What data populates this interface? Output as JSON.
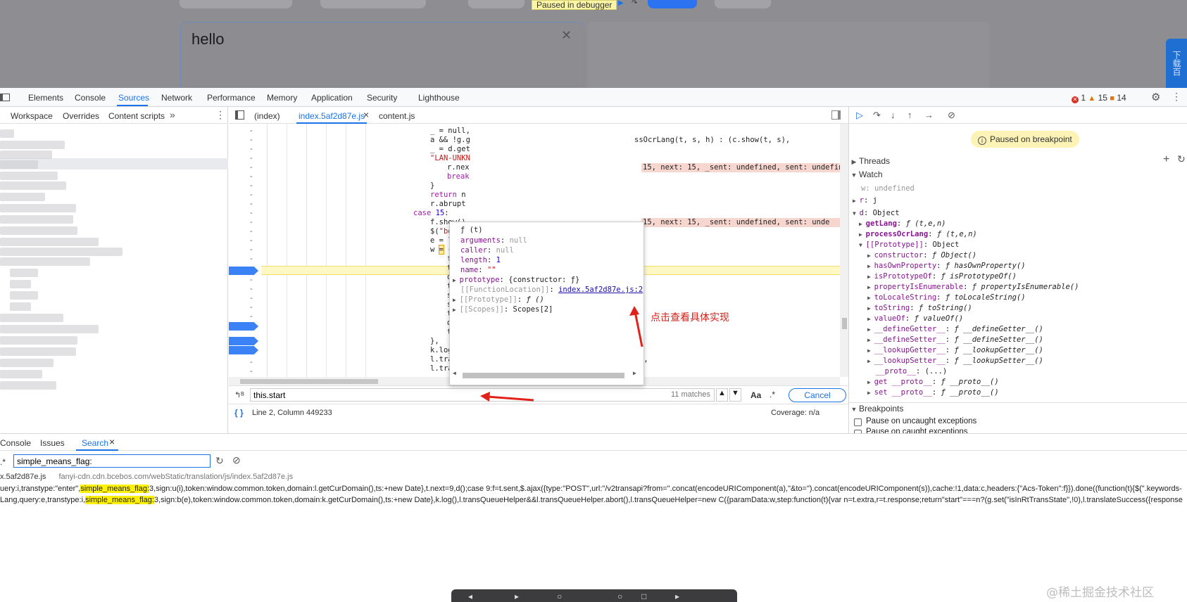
{
  "webpage": {
    "debugger_badge": "Paused in debugger",
    "input_text": "hello",
    "close_glyph": "✕",
    "side_banner": "下载百"
  },
  "devtools": {
    "tabs": [
      "Elements",
      "Console",
      "Sources",
      "Network",
      "Performance",
      "Memory",
      "Application",
      "Security",
      "Lighthouse"
    ],
    "active_tab": "Sources",
    "errors": "1",
    "warnings": "15",
    "issues": "14"
  },
  "navigator": {
    "tabs": [
      "Workspace",
      "Overrides",
      "Content scripts"
    ],
    "more": "»"
  },
  "editor": {
    "tabs": [
      "(index)",
      "index.5af2d87e.js",
      "content.js"
    ],
    "active_tab": "index.5af2d87e.js",
    "search": {
      "query": "this.start",
      "count": "11 matches",
      "match_case": "Aa",
      "regex": ".*",
      "cancel": "Cancel"
    },
    "status": {
      "position": "Line 2, Column 449233",
      "coverage": "Coverage: n/a"
    }
  },
  "popover": {
    "title": "ƒ (t)",
    "rows": [
      {
        "key": "arguments",
        "value": "null"
      },
      {
        "key": "caller",
        "value": "null"
      },
      {
        "key": "length",
        "value": "1"
      },
      {
        "key": "name",
        "value": "\"\""
      },
      {
        "key": "prototype",
        "value": "{constructor: ƒ}"
      },
      {
        "key": "[[FunctionLocation]]",
        "value": "index.5af2d87e.js:2"
      },
      {
        "key": "[[Prototype]]",
        "value": "ƒ ()"
      },
      {
        "key": "[[Scopes]]",
        "value": "Scopes[2]"
      }
    ]
  },
  "annotation": {
    "text": "点击查看具体实现"
  },
  "debugger": {
    "paused_banner": "Paused on breakpoint",
    "threads": "Threads",
    "watch": "Watch",
    "breakpoints": "Breakpoints",
    "pause_uncaught": "Pause on uncaught exceptions",
    "pause_caught": "Pause on caught exceptions",
    "watch_rows": [
      {
        "key": "w",
        "sep": ": ",
        "value": "undefined"
      },
      {
        "key": "r",
        "sep": ": ",
        "value": "j"
      },
      {
        "key": "d",
        "sep": ": ",
        "value": "Object"
      },
      {
        "key": "getLang",
        "sep": ": ",
        "value": "ƒ (t,e,n)"
      },
      {
        "key": "processOcrLang",
        "sep": ": ",
        "value": "ƒ (t,e,n)"
      },
      {
        "key": "[[Prototype]]",
        "sep": ": ",
        "value": "Object"
      },
      {
        "key": "constructor",
        "sep": ": ",
        "value": "ƒ Object()"
      },
      {
        "key": "hasOwnProperty",
        "sep": ": ",
        "value": "ƒ hasOwnProperty()"
      },
      {
        "key": "isPrototypeOf",
        "sep": ": ",
        "value": "ƒ isPrototypeOf()"
      },
      {
        "key": "propertyIsEnumerable",
        "sep": ": ",
        "value": "ƒ propertyIsEnumerable()"
      },
      {
        "key": "toLocaleString",
        "sep": ": ",
        "value": "ƒ toLocaleString()"
      },
      {
        "key": "toString",
        "sep": ": ",
        "value": "ƒ toString()"
      },
      {
        "key": "valueOf",
        "sep": ": ",
        "value": "ƒ valueOf()"
      },
      {
        "key": "__defineGetter__",
        "sep": ": ",
        "value": "ƒ __defineGetter__()"
      },
      {
        "key": "__defineSetter__",
        "sep": ": ",
        "value": "ƒ __defineSetter__()"
      },
      {
        "key": "__lookupGetter__",
        "sep": ": ",
        "value": "ƒ __lookupGetter__()"
      },
      {
        "key": "__lookupSetter__",
        "sep": ": ",
        "value": "ƒ __lookupSetter__()"
      },
      {
        "key": "__proto__",
        "sep": ": ",
        "value": "(...)"
      },
      {
        "key": "get __proto__",
        "sep": ": ",
        "value": "ƒ __proto__()"
      },
      {
        "key": "set __proto__",
        "sep": ": ",
        "value": "ƒ __proto__()"
      }
    ]
  },
  "drawer": {
    "tabs": [
      "Console",
      "Issues",
      "Search"
    ],
    "active_tab": "Search",
    "regex": ".*",
    "search_value": "simple_means_flag:",
    "result_file": "x.5af2d87e.js",
    "result_url": "fanyi-cdn.cdn.bcebos.com/webStatic/translation/js/index.5af2d87e.js",
    "line1_pre": "uery:i,transtype:\"enter\",",
    "line1_hl": "simple_means_flag:",
    "line1_post": "3,sign:u(i),token:window.common.token,domain:l.getCurDomain(),ts:+new Date},t.next=9,d();case 9:f=t.sent,$.ajax({type:\"POST\",url:\"/v2transapi?from=\".concat(encodeURIComponent(a),\"&to=\").concat(encodeURIComponent(s)),cache:!1,data:c,headers:{\"Acs-Token\":f}}).done((function(t){$(\".keywords-",
    "line2_pre": "Lang,query:e,transtype:i,",
    "line2_hl": "simple_means_flag:",
    "line2_post": "3,sign:b(e),token:window.common.token,domain:k.getCurDomain(),ts:+new Date},k.log(),l.transQueueHelper&&l.transQueueHelper.abort(),l.transQueueHelper=new C({paramData:w,step:function(t){var n=t.extra,r=t.response;return\"start\"===n?(g.set(\"isInRtTransState\",!0),l.translateSuccess({response"
  },
  "watermark": "@稀土掘金技术社区"
}
